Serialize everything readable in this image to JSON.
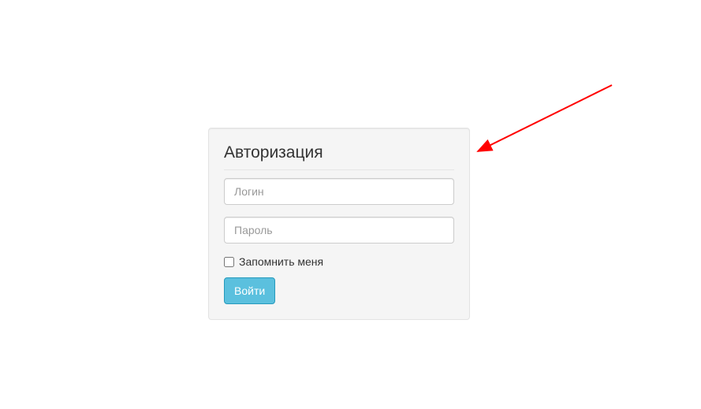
{
  "login": {
    "title": "Авторизация",
    "username_placeholder": "Логин",
    "password_placeholder": "Пароль",
    "remember_label": "Запомнить меня",
    "submit_label": "Войти"
  }
}
